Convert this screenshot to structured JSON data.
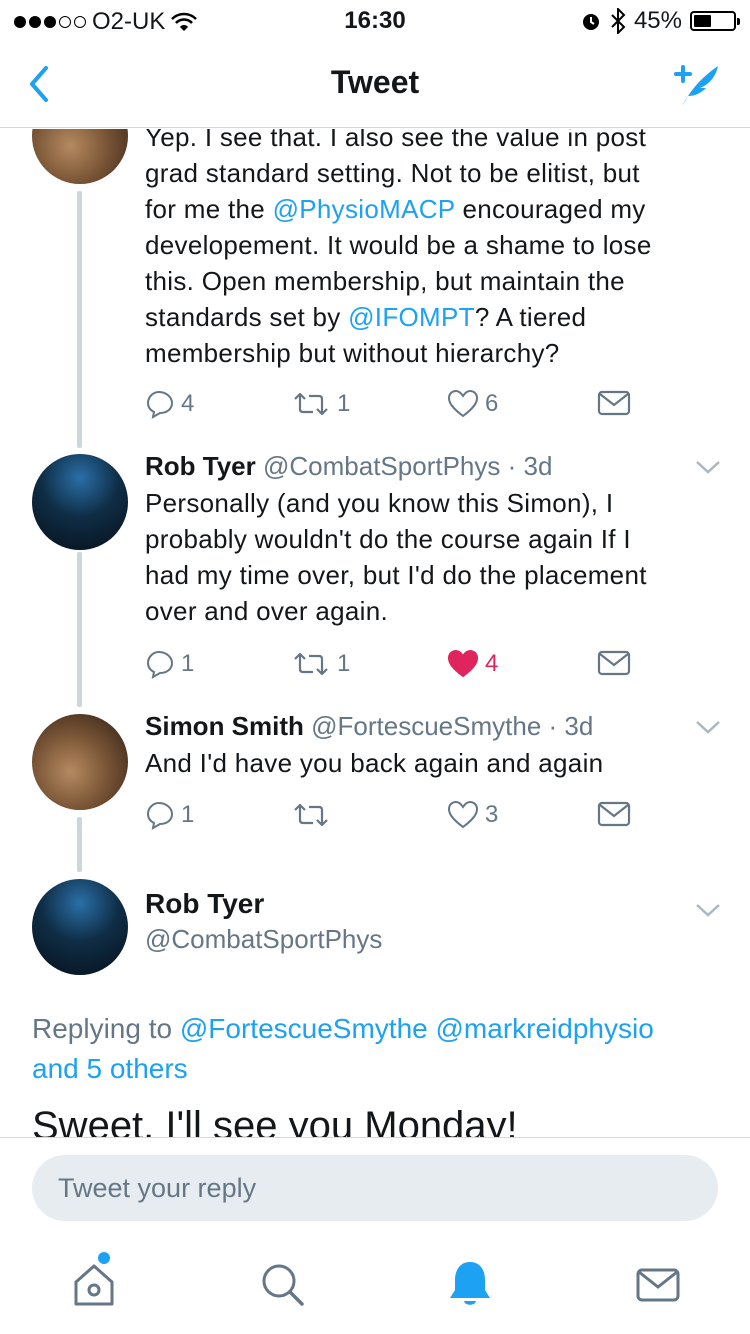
{
  "status_bar": {
    "carrier": "O2-UK",
    "time": "16:30",
    "battery": "45%",
    "battery_level": 0.45
  },
  "nav": {
    "title": "Tweet"
  },
  "colors": {
    "accent": "#1da1f2",
    "like": "#e0245e",
    "muted": "#657786",
    "thread_line": "#ccd6dd"
  },
  "tweets": [
    {
      "lines": [
        [
          "Yep. I see that. I also see the value in post"
        ],
        [
          "grad standard setting. Not to be elitist, but"
        ],
        [
          "for me the ",
          "@PhysioMACP",
          " encouraged my"
        ],
        [
          "developement. It would be a shame to lose"
        ],
        [
          "this. Open membership, but maintain the"
        ],
        [
          "standards set by ",
          "@IFOMPT",
          "? A tiered"
        ],
        [
          "membership but without hierarchy?"
        ]
      ],
      "replies": "4",
      "retweets": "1",
      "likes": "6"
    },
    {
      "name": "Rob Tyer",
      "handle": "@CombatSportPhys",
      "sep": "·",
      "time": "3d",
      "lines": [
        "Personally (and you know this Simon), I",
        "probably wouldn't do the course again If I",
        "had my time over, but I'd do the placement",
        "over and over again."
      ],
      "replies": "1",
      "retweets": "1",
      "likes": "4"
    },
    {
      "name": "Simon Smith",
      "handle": "@FortescueSmythe",
      "sep": "·",
      "time": "3d",
      "text": "And I'd have you back again and again",
      "replies": "1",
      "retweets": "",
      "likes": "3"
    }
  ],
  "focused": {
    "name": "Rob Tyer",
    "handle": "@CombatSportPhys",
    "replying_prefix": "Replying to ",
    "replying_mention_1": "@FortescueSmythe",
    "replying_mention_2": "@markreidphysio",
    "replying_others": "and 5 others",
    "text": "Sweet. I'll see you Monday!"
  },
  "reply_bar": {
    "placeholder": "Tweet your reply"
  }
}
